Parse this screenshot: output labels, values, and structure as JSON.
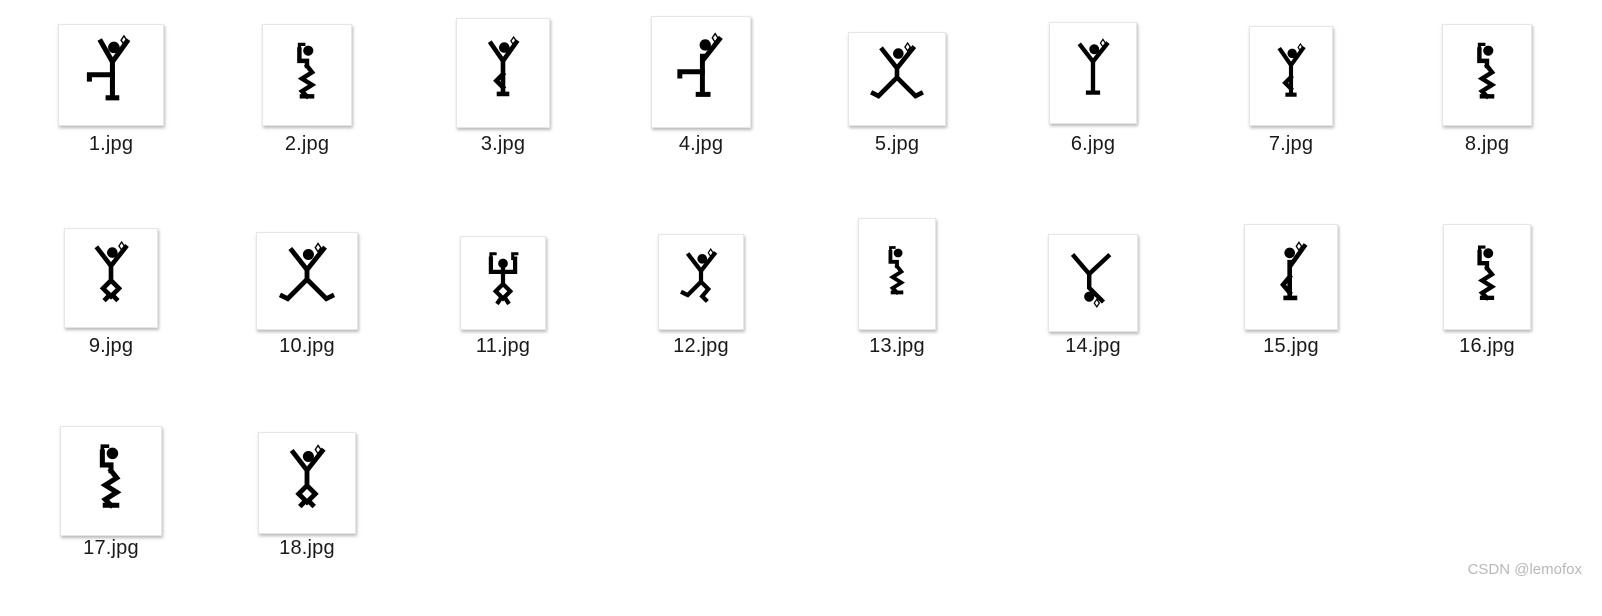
{
  "files": [
    {
      "name": "1.jpg",
      "pose": "one-leg-left"
    },
    {
      "name": "2.jpg",
      "pose": "flag-twist"
    },
    {
      "name": "3.jpg",
      "pose": "y-knot"
    },
    {
      "name": "4.jpg",
      "pose": "one-leg-left-arm"
    },
    {
      "name": "5.jpg",
      "pose": "x-jump"
    },
    {
      "name": "6.jpg",
      "pose": "y-straight"
    },
    {
      "name": "7.jpg",
      "pose": "y-knot"
    },
    {
      "name": "8.jpg",
      "pose": "flag-twist"
    },
    {
      "name": "9.jpg",
      "pose": "y-diamond"
    },
    {
      "name": "10.jpg",
      "pose": "x-jump"
    },
    {
      "name": "11.jpg",
      "pose": "hands-up-diamond"
    },
    {
      "name": "12.jpg",
      "pose": "y-kick"
    },
    {
      "name": "13.jpg",
      "pose": "flag-twist"
    },
    {
      "name": "14.jpg",
      "pose": "inverted"
    },
    {
      "name": "15.jpg",
      "pose": "one-arm-knot"
    },
    {
      "name": "16.jpg",
      "pose": "flag-twist"
    },
    {
      "name": "17.jpg",
      "pose": "flag-twist"
    },
    {
      "name": "18.jpg",
      "pose": "y-diamond"
    }
  ],
  "watermark": "CSDN @lemofox",
  "colors": {
    "figure": "#000000",
    "label": "#1a1a1a",
    "watermark": "#b8b8b8"
  }
}
